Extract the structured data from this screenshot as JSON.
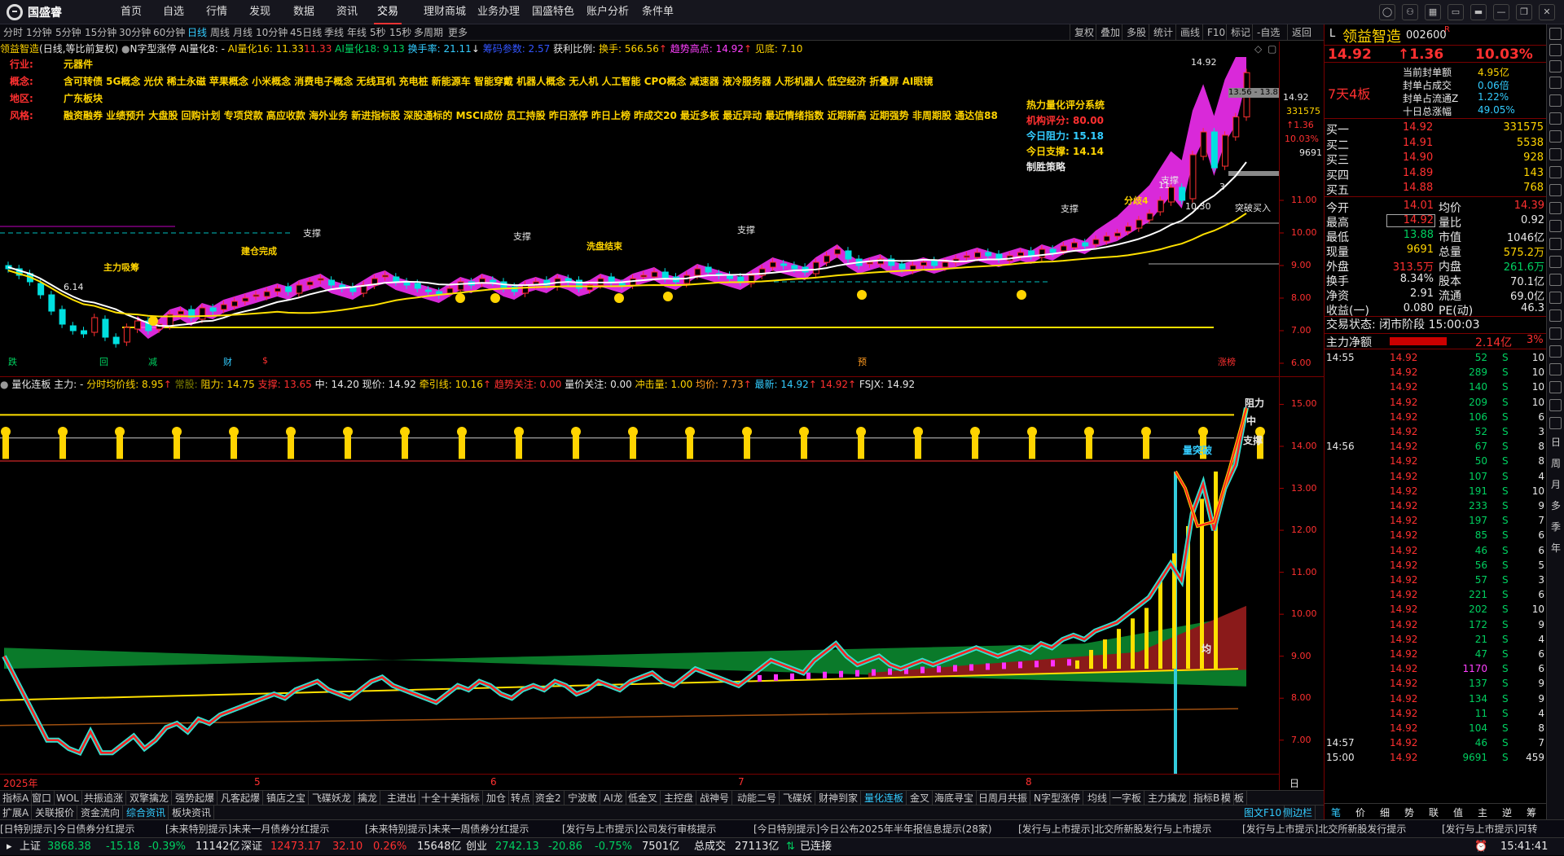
{
  "menu": {
    "logo": "国盛睿",
    "items": [
      "首页",
      "自选",
      "行情",
      "发现",
      "数据",
      "资讯",
      "交易",
      "理财商城",
      "业务办理",
      "国盛特色",
      "账户分析",
      "条件单"
    ],
    "active_index": 6
  },
  "periods": {
    "items": [
      "分时",
      "1分钟",
      "5分钟",
      "15分钟",
      "30分钟",
      "60分钟",
      "日线",
      "周线",
      "月线",
      "10分钟",
      "45日线",
      "季线",
      "年线",
      "5秒",
      "15秒",
      "多周期",
      "更多"
    ],
    "active_index": 6,
    "tools": [
      "复权",
      "叠加",
      "多股",
      "统计",
      "画线",
      "F10",
      "标记",
      "-自选",
      "返回"
    ]
  },
  "info": {
    "name": "领益智造",
    "mode": "(日线,等比前复权)",
    "formula": "N字型涨停",
    "ai8_label": "AI量化8: -",
    "ai16": "AI量化16: 11.33",
    "ai16_val": "11.33",
    "ai18": "AI量化18: 9.13",
    "turnover": "换手率: 21.11",
    "turnover_arrow": "↓",
    "cost": "筹码参数: 2.57",
    "profit_label": "获利比例:",
    "hs": "换手: 566.56",
    "hs_arrow": "↑",
    "trend_high": "趋势高点: 14.92",
    "trend_arrow": "↑",
    "bottom": "见底: 7.10"
  },
  "overlay": {
    "industry_label": "行业:",
    "industry": "元器件",
    "concept_label": "概念:",
    "concepts": "含可转债 5G概念 光伏 稀土永磁 苹果概念 小米概念 消费电子概念 无线耳机 充电桩 新能源车 智能穿戴 机器人概念 无人机 人工智能 CPO概念 减速器 液冷服务器 人形机器人 低空经济 折叠屏 AI眼镜",
    "region_label": "地区:",
    "region": "广东板块",
    "style_label": "风格:",
    "styles": "融资融券 业绩预升 大盘股 回购计划 专项贷款 高应收款 海外业务 新进指标股 深股通标的 MSCI成份 员工持股 昨日涨停 昨日上榜 昨成交20 最近多板 最近异动 最近情绪指数 近期新高 近期强势 非周期股 通达信88",
    "system_title": "热力量化评分系统",
    "inst_score": "机构评分: 80.00",
    "resist": "今日阻力: 15.18",
    "support": "今日支撑: 14.14",
    "win": "制胜策略"
  },
  "chart1_labels": {
    "high": "14.92",
    "cur_price_box": "13.56 - 13.8",
    "val_11": "11",
    "val_3": "3",
    "price_1030": "10.30",
    "low_label": "6.14",
    "breakout": "突破买入",
    "zhucheng": "主力吸筹",
    "jiancang": "建仓完成",
    "xipan": "洗盘结束",
    "fenqi": "分歧4",
    "zhicheng": "支撑",
    "bottom_tags": [
      "跌",
      "回",
      "减",
      "财",
      "$"
    ],
    "bottom_tags_right": [
      "预",
      "涨榜"
    ]
  },
  "yaxis1": {
    "labels": [
      "14.92",
      "331575",
      "↑1.36",
      "10.03%",
      "9691",
      "11.00",
      "10.00",
      "9.00",
      "8.00",
      "7.00",
      "6.00"
    ],
    "ticks": [
      11,
      10,
      9,
      8,
      7,
      6
    ]
  },
  "ind1": {
    "name": "量化连板",
    "main": "主力: -",
    "avg": "分时均价线: 8.95",
    "avg_arrow": "↑",
    "chang": "常股:",
    "resist": "阻力: 14.75",
    "support": "支撑: 13.65",
    "mid": "中: 14.20",
    "now": "现价: 14.92",
    "pull": "牵引线: 10.16",
    "pull_arrow": "↑",
    "trend": "趋势关注: 0.00",
    "vol": "量价关注: 0.00",
    "impact": "冲击量: 1.00",
    "avgp": "均价: 7.73",
    "avgp_arrow": "↑",
    "latest": "最新: 14.92",
    "latest_arrow": "↑",
    "v14": "14.92",
    "v14_arrow": "↑",
    "fsjx": "FSJX: 14.92",
    "tag_resist": "阻力",
    "tag_mid": "中",
    "tag_support": "支撑",
    "tag_break": "量突破",
    "tag_avg": "均"
  },
  "yaxis2": {
    "ticks": [
      15,
      14,
      13,
      12,
      11,
      10,
      9,
      8,
      7
    ],
    "labels": [
      "15.00",
      "14.00",
      "13.00",
      "12.00",
      "11.00",
      "10.00",
      "9.00",
      "8.00",
      "7.00"
    ]
  },
  "xaxis": {
    "labels": [
      "2025年",
      "5",
      "6",
      "7",
      "8"
    ],
    "right": "日线"
  },
  "tabs1": [
    "指标A",
    "窗口",
    "WOL",
    "共振追涨",
    "双擎擒龙",
    "强势起爆",
    "凡客起爆",
    "镇店之宝",
    "飞碟妖龙",
    "擒龙",
    "主进出",
    "十全十美指标",
    "加仓",
    "转点",
    "资金2",
    "宁波敢",
    "AI龙",
    "低金叉",
    "主控盘",
    "战神号",
    "动能二号",
    "飞碟妖",
    "财神到家",
    "量化连板",
    "金叉",
    "海底寻宝",
    "日周月共振",
    "N字型涨停",
    "均线",
    "一字板",
    "主力擒龙",
    "指标B",
    "模",
    "板"
  ],
  "tabs1_active": 23,
  "tabs2": [
    "扩展A",
    "关联报价",
    "资金流向",
    "综合资讯",
    "板块资讯"
  ],
  "tabs2_right": [
    "图文F10",
    "侧边栏"
  ],
  "news": [
    "[日特别提示]今日债券分红提示",
    "[未来特别提示]未来一月债券分红提示",
    "[未来特别提示]未来一周债券分红提示",
    "[发行与上市提示]公司发行审核提示",
    "[今日特别提示]今日公布2025年半年报信息提示(28家)",
    "[发行与上市提示]北交所新股发行与上市提示",
    "[发行与上市提示]北交所新股发行提示",
    "[发行与上市提示]可转"
  ],
  "status": {
    "sh_label": "上证",
    "sh": "3868.38",
    "sh_chg": "-15.18",
    "sh_pct": "-0.39%",
    "sh_amt": "11142亿",
    "sz_label": "深证",
    "sz": "12473.17",
    "sz_chg": "32.10",
    "sz_pct": "0.26%",
    "sz_amt": "15648亿",
    "cy_label": "创业",
    "cy": "2742.13",
    "cy_chg": "-20.86",
    "cy_pct": "-0.75%",
    "cy_amt": "7501亿",
    "total_label": "总成交",
    "total": "27113亿",
    "conn": "已连接",
    "time": "15:41:41"
  },
  "right": {
    "prefix": "L",
    "name": "领益智造",
    "code": "002600",
    "tag": "R",
    "price": "14.92",
    "change": "↑1.36",
    "pct": "10.03%",
    "board": "7天4板",
    "seal_rows": [
      {
        "l": "当前封单额",
        "v": "4.95亿"
      },
      {
        "l": "封单占成交",
        "v": "0.06倍"
      },
      {
        "l": "封单占流通Z",
        "v": "1.22%"
      },
      {
        "l": "十日总涨幅",
        "v": "49.05%"
      }
    ],
    "buys": [
      {
        "l": "买一",
        "p": "14.92",
        "v": "331575"
      },
      {
        "l": "买二",
        "p": "14.91",
        "v": "5538"
      },
      {
        "l": "买三",
        "p": "14.90",
        "v": "928"
      },
      {
        "l": "买四",
        "p": "14.89",
        "v": "143"
      },
      {
        "l": "买五",
        "p": "14.88",
        "v": "768"
      }
    ],
    "stats": [
      {
        "l1": "今开",
        "v1": "14.01",
        "l2": "均价",
        "v2": "14.39"
      },
      {
        "l1": "最高",
        "v1": "14.92",
        "l2": "量比",
        "v2": "0.92"
      },
      {
        "l1": "最低",
        "v1": "13.88",
        "l2": "市值",
        "v2": "1046亿"
      },
      {
        "l1": "现量",
        "v1": "9691",
        "l2": "总量",
        "v2": "575.2万"
      },
      {
        "l1": "外盘",
        "v1": "313.5万",
        "l2": "内盘",
        "v2": "261.6万"
      },
      {
        "l1": "换手",
        "v1": "8.34%",
        "l2": "股本",
        "v2": "70.1亿"
      },
      {
        "l1": "净资",
        "v1": "2.91",
        "l2": "流通",
        "v2": "69.0亿"
      },
      {
        "l1": "收益(一)",
        "v1": "0.080",
        "l2": "PE(动)",
        "v2": "46.3"
      }
    ],
    "trade_state": "交易状态: 闭市阶段 15:00:03",
    "fund_label": "主力净额",
    "fund": "2.14亿",
    "fund_pct": "3%",
    "ticks": [
      {
        "t": "14:55",
        "p": "14.92",
        "v": "52",
        "s": "S",
        "n": "10"
      },
      {
        "t": "",
        "p": "14.92",
        "v": "289",
        "s": "S",
        "n": "10"
      },
      {
        "t": "",
        "p": "14.92",
        "v": "140",
        "s": "S",
        "n": "10"
      },
      {
        "t": "",
        "p": "14.92",
        "v": "209",
        "s": "S",
        "n": "10"
      },
      {
        "t": "",
        "p": "14.92",
        "v": "106",
        "s": "S",
        "n": "6"
      },
      {
        "t": "",
        "p": "14.92",
        "v": "52",
        "s": "S",
        "n": "3"
      },
      {
        "t": "14:56",
        "p": "14.92",
        "v": "67",
        "s": "S",
        "n": "8"
      },
      {
        "t": "",
        "p": "14.92",
        "v": "50",
        "s": "S",
        "n": "8"
      },
      {
        "t": "",
        "p": "14.92",
        "v": "107",
        "s": "S",
        "n": "4"
      },
      {
        "t": "",
        "p": "14.92",
        "v": "191",
        "s": "S",
        "n": "10"
      },
      {
        "t": "",
        "p": "14.92",
        "v": "233",
        "s": "S",
        "n": "9"
      },
      {
        "t": "",
        "p": "14.92",
        "v": "197",
        "s": "S",
        "n": "7"
      },
      {
        "t": "",
        "p": "14.92",
        "v": "85",
        "s": "S",
        "n": "6"
      },
      {
        "t": "",
        "p": "14.92",
        "v": "46",
        "s": "S",
        "n": "6"
      },
      {
        "t": "",
        "p": "14.92",
        "v": "56",
        "s": "S",
        "n": "5"
      },
      {
        "t": "",
        "p": "14.92",
        "v": "57",
        "s": "S",
        "n": "3"
      },
      {
        "t": "",
        "p": "14.92",
        "v": "221",
        "s": "S",
        "n": "6"
      },
      {
        "t": "",
        "p": "14.92",
        "v": "202",
        "s": "S",
        "n": "10"
      },
      {
        "t": "",
        "p": "14.92",
        "v": "172",
        "s": "S",
        "n": "9"
      },
      {
        "t": "",
        "p": "14.92",
        "v": "21",
        "s": "S",
        "n": "4"
      },
      {
        "t": "",
        "p": "14.92",
        "v": "47",
        "s": "S",
        "n": "6"
      },
      {
        "t": "",
        "p": "14.92",
        "v": "1170",
        "s": "S",
        "n": "6"
      },
      {
        "t": "",
        "p": "14.92",
        "v": "137",
        "s": "S",
        "n": "9"
      },
      {
        "t": "",
        "p": "14.92",
        "v": "134",
        "s": "S",
        "n": "9"
      },
      {
        "t": "",
        "p": "14.92",
        "v": "11",
        "s": "S",
        "n": "4"
      },
      {
        "t": "",
        "p": "14.92",
        "v": "104",
        "s": "S",
        "n": "8"
      },
      {
        "t": "14:57",
        "p": "14.92",
        "v": "46",
        "s": "S",
        "n": "7"
      },
      {
        "t": "15:00",
        "p": "14.92",
        "v": "9691",
        "s": "S",
        "n": "459"
      }
    ],
    "bottom_tabs": [
      "笔",
      "价",
      "细",
      "势",
      "联",
      "值",
      "主",
      "逆",
      "筹"
    ]
  },
  "sidebar": {
    "vtext": [
      "日",
      "周",
      "月",
      "多",
      "季",
      "年"
    ]
  },
  "chart_data": {
    "type": "candlestick",
    "ylim": [
      5.6,
      15.4
    ],
    "price_tick_values": [
      6,
      7,
      8,
      9,
      10,
      11,
      14.92
    ],
    "close": [
      8.9,
      8.7,
      8.5,
      8.1,
      7.6,
      7.2,
      7.0,
      6.9,
      7.4,
      6.8,
      6.6,
      7.1,
      7.3,
      7.0,
      7.2,
      7.5,
      7.6,
      7.4,
      7.7,
      7.6,
      7.8,
      7.9,
      8.0,
      8.1,
      8.2,
      8.3,
      8.2,
      8.4,
      8.5,
      8.6,
      8.4,
      8.3,
      8.2,
      8.4,
      8.6,
      8.7,
      8.5,
      8.4,
      8.3,
      8.2,
      8.1,
      8.3,
      8.5,
      8.4,
      8.6,
      8.5,
      8.3,
      8.2,
      8.4,
      8.5,
      8.4,
      8.6,
      8.5,
      8.3,
      8.4,
      8.6,
      8.5,
      8.4,
      8.6,
      8.7,
      8.8,
      8.6,
      8.5,
      8.7,
      8.9,
      8.8,
      8.7,
      8.6,
      8.5,
      8.7,
      8.9,
      9.1,
      9.0,
      8.9,
      8.8,
      9.1,
      9.3,
      9.5,
      9.2,
      9.0,
      9.1,
      9.2,
      9.0,
      8.9,
      9.0,
      9.1,
      9.0,
      9.1,
      9.2,
      9.3,
      9.4,
      9.3,
      9.2,
      9.3,
      9.4,
      9.3,
      9.5,
      9.4,
      9.6,
      9.7,
      9.6,
      9.8,
      9.9,
      10.0,
      10.2,
      10.4,
      10.6,
      11.0,
      11.4,
      11.0,
      12.4,
      13.1,
      12.0,
      13.0,
      13.56,
      14.92
    ]
  }
}
